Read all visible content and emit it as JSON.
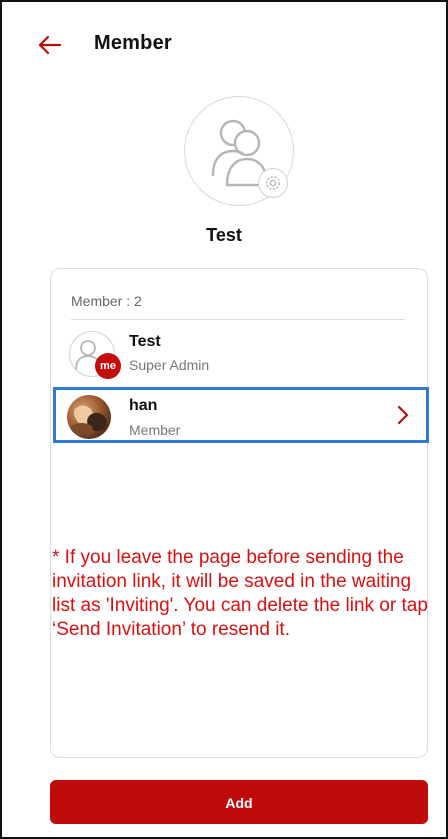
{
  "header": {
    "title": "Member",
    "back_icon": "arrow-left-icon"
  },
  "group": {
    "name": "Test",
    "avatar_icon": "people-icon",
    "settings_icon": "gear-icon"
  },
  "members": {
    "count_label": "Member : 2",
    "items": [
      {
        "name": "Test",
        "role": "Super Admin",
        "badge": "me",
        "avatar": "person-icon"
      },
      {
        "name": "han",
        "role": "Member",
        "avatar": "photo",
        "action_icon": "chevron-right-icon"
      }
    ]
  },
  "notice": {
    "text": "* If you leave the page before sending the invitation link, it will be saved in the waiting list as 'Inviting'. You can delete the link or tap ‘Send Invitation’ to resend it."
  },
  "footer": {
    "add_label": "Add"
  },
  "colors": {
    "accent": "#c00b0b",
    "notice": "#d91010",
    "highlight": "#2f7ad3"
  }
}
